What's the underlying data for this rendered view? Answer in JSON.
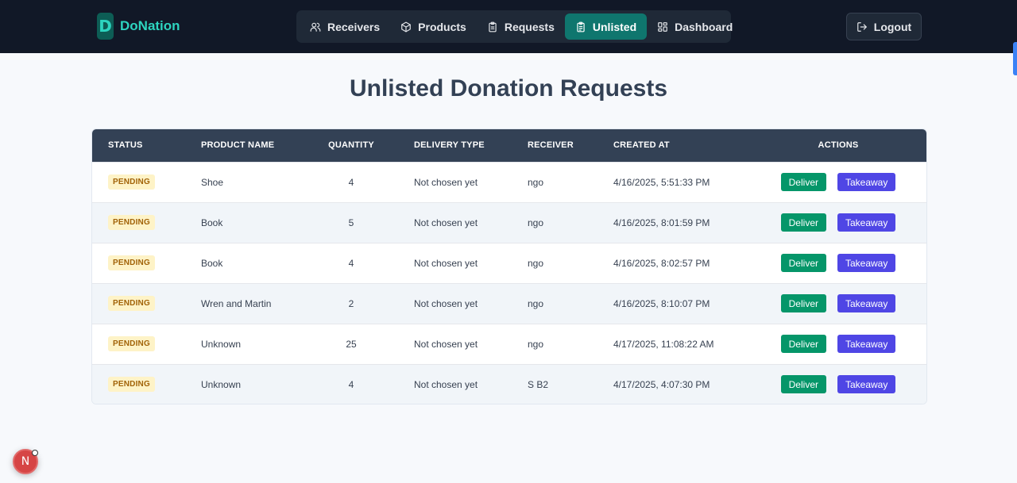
{
  "brand": {
    "logo_letter": "D",
    "name": "DoNation",
    "color": "#2dd4bf"
  },
  "nav": {
    "items": [
      {
        "label": "Receivers",
        "icon": "users-icon"
      },
      {
        "label": "Products",
        "icon": "box-icon"
      },
      {
        "label": "Requests",
        "icon": "clipboard-icon"
      },
      {
        "label": "Unlisted",
        "icon": "clipboard-list-icon",
        "active": true
      },
      {
        "label": "Dashboard",
        "icon": "grid-icon"
      }
    ],
    "active_color": "#0f766e"
  },
  "logout": {
    "label": "Logout",
    "icon": "logout-icon"
  },
  "page": {
    "title": "Unlisted Donation Requests"
  },
  "table": {
    "headers": [
      "STATUS",
      "PRODUCT NAME",
      "QUANTITY",
      "DELIVERY TYPE",
      "RECEIVER",
      "CREATED AT",
      "ACTIONS"
    ],
    "rows": [
      {
        "status": "PENDING",
        "product": "Shoe",
        "quantity": "4",
        "delivery": "Not chosen yet",
        "receiver": "ngo",
        "created": "4/16/2025, 5:51:33 PM",
        "deliver": "Deliver",
        "takeaway": "Takeaway"
      },
      {
        "status": "PENDING",
        "product": "Book",
        "quantity": "5",
        "delivery": "Not chosen yet",
        "receiver": "ngo",
        "created": "4/16/2025, 8:01:59 PM",
        "deliver": "Deliver",
        "takeaway": "Takeaway"
      },
      {
        "status": "PENDING",
        "product": "Book",
        "quantity": "4",
        "delivery": "Not chosen yet",
        "receiver": "ngo",
        "created": "4/16/2025, 8:02:57 PM",
        "deliver": "Deliver",
        "takeaway": "Takeaway"
      },
      {
        "status": "PENDING",
        "product": "Wren and Martin",
        "quantity": "2",
        "delivery": "Not chosen yet",
        "receiver": "ngo",
        "created": "4/16/2025, 8:10:07 PM",
        "deliver": "Deliver",
        "takeaway": "Takeaway"
      },
      {
        "status": "PENDING",
        "product": "Unknown",
        "quantity": "25",
        "delivery": "Not chosen yet",
        "receiver": "ngo",
        "created": "4/17/2025, 11:08:22 AM",
        "deliver": "Deliver",
        "takeaway": "Takeaway"
      },
      {
        "status": "PENDING",
        "product": "Unknown",
        "quantity": "4",
        "delivery": "Not chosen yet",
        "receiver": "S B2",
        "created": "4/17/2025, 4:07:30 PM",
        "deliver": "Deliver",
        "takeaway": "Takeaway"
      }
    ]
  },
  "floating": {
    "letter": "N"
  },
  "colors": {
    "deliver": "#059669",
    "takeaway": "#4f46e5",
    "badge_bg": "#fef3c7",
    "badge_text": "#a16207",
    "header_bg": "#334155"
  }
}
